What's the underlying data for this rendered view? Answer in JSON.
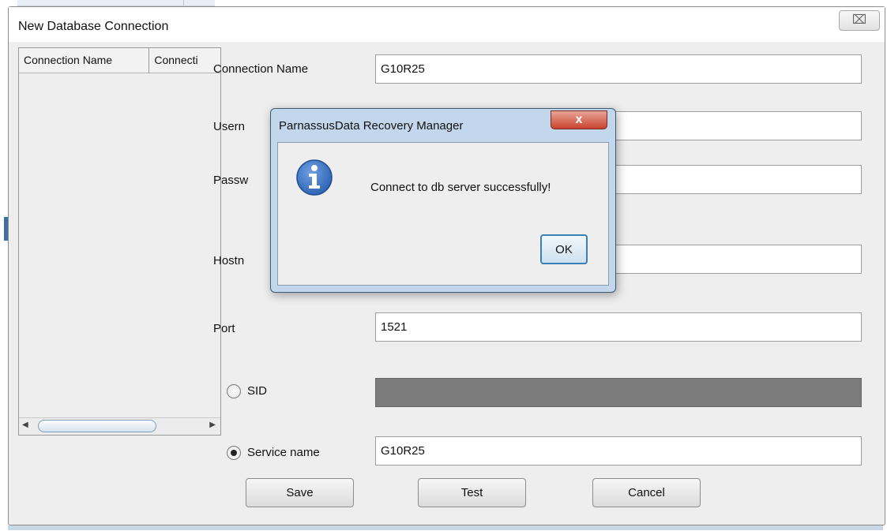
{
  "dialog": {
    "title": "New Database Connection",
    "close_glyph": "⌧"
  },
  "connection_list": {
    "columns": [
      "Connection Name",
      "Connecti"
    ]
  },
  "form": {
    "connection_name_label": "Connection Name",
    "connection_name_value": "G10R25",
    "username_label": "Usern",
    "password_label": "Passw",
    "hostname_label": "Hostn",
    "port_label": "Port",
    "port_value": "1521",
    "sid_label": "SID",
    "service_name_label": "Service name",
    "service_name_value": "G10R25",
    "selected_mode": "Service name"
  },
  "buttons": {
    "save": "Save",
    "test": "Test",
    "cancel": "Cancel"
  },
  "message_box": {
    "title": "ParnassusData Recovery Manager",
    "close_glyph": "x",
    "message": "Connect to db server successfully!",
    "ok": "OK",
    "icon": "info-icon"
  },
  "colors": {
    "info_icon": "#2f66b8",
    "close_button_red": "#c8442e",
    "disabled_field": "#7b7b7b"
  }
}
